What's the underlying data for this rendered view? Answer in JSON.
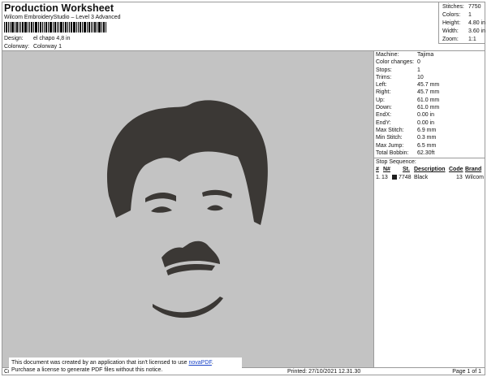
{
  "header": {
    "title": "Production Worksheet",
    "subtitle": "Wilcom EmbroideryStudio – Level 3 Advanced",
    "design_label": "Design:",
    "design_value": "el chapo 4,8 in",
    "colorway_label": "Colorway:",
    "colorway_value": "Colorway 1"
  },
  "summary": [
    {
      "label": "Stitches:",
      "value": "7750"
    },
    {
      "label": "Colors:",
      "value": "1"
    },
    {
      "label": "Height:",
      "value": "4.80 in"
    },
    {
      "label": "Width:",
      "value": "3.60 in"
    },
    {
      "label": "Zoom:",
      "value": "1:1"
    }
  ],
  "machine_info": [
    {
      "label": "Machine:",
      "value": "Tajima"
    },
    {
      "label": "Color changes:",
      "value": "0"
    },
    {
      "label": "Stops:",
      "value": "1"
    },
    {
      "label": "Trims:",
      "value": "10"
    },
    {
      "label": "Left:",
      "value": "45.7 mm"
    },
    {
      "label": "Right:",
      "value": "45.7 mm"
    },
    {
      "label": "Up:",
      "value": "61.0 mm"
    },
    {
      "label": "Down:",
      "value": "61.0 mm"
    },
    {
      "label": "EndX:",
      "value": "0.00 in"
    },
    {
      "label": "EndY:",
      "value": "0.00 in"
    },
    {
      "label": "Max Stitch:",
      "value": "6.9 mm"
    },
    {
      "label": "Min Stitch:",
      "value": "0.3 mm"
    },
    {
      "label": "Max Jump:",
      "value": "6.5 mm"
    },
    {
      "label": "Total Bobbin:",
      "value": "62.30ft"
    }
  ],
  "stop_sequence": {
    "title": "Stop Sequence:",
    "headers": [
      "#",
      "N#",
      "St.",
      "Description",
      "Code",
      "Brand"
    ],
    "rows": [
      {
        "index": "1.",
        "needle": "13",
        "stitches": "7748",
        "description": "Black",
        "code": "13",
        "brand": "Wilcom"
      }
    ],
    "thread_color": "#1e1e1e"
  },
  "design_colors": {
    "canvas_background": "#c3c3c3",
    "thread": "#3b3835"
  },
  "footer": {
    "left": "Cr",
    "printed": "Printed: 27/10/2021 12.31.30",
    "page": "Page 1 of 1"
  },
  "notice": {
    "line1_prefix": "This document was created by an application that isn't licensed to use ",
    "link": "novaPDF",
    "line1_suffix": ".",
    "line2": "Purchase a license to generate PDF files without this notice."
  }
}
